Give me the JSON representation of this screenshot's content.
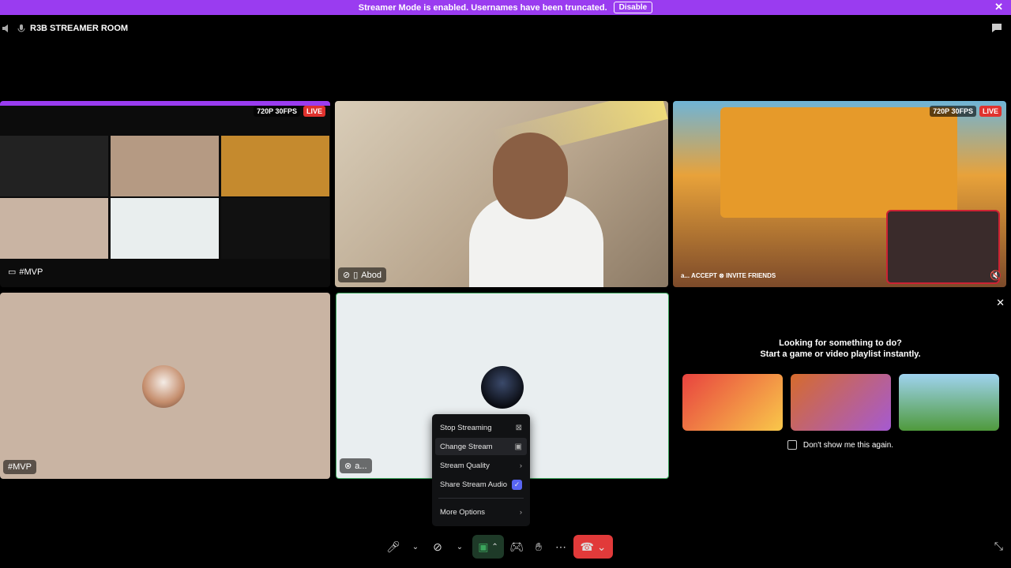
{
  "banner": {
    "text": "Streamer Mode is enabled. Usernames have been truncated.",
    "button": "Disable"
  },
  "channel": {
    "name": "R3B STREAMER ROOM"
  },
  "tiles": {
    "mvp_screen": {
      "label": "#MVP",
      "quality": "720P 30FPS",
      "live": "LIVE"
    },
    "abod": {
      "label": "Abod"
    },
    "game": {
      "quality": "720P 30FPS",
      "live": "LIVE",
      "caption": "a... ACCEPT  ⊗ INVITE FRIENDS"
    },
    "mvp_cam": {
      "label": "#MVP"
    },
    "self": {
      "label": "a..."
    }
  },
  "context_menu": {
    "items": [
      "Stop Streaming",
      "Change Stream",
      "Stream Quality",
      "Share Stream Audio",
      "More Options"
    ]
  },
  "suggest": {
    "title_line1": "Looking for something to do?",
    "title_line2": "Start a game or video playlist instantly.",
    "dont_show": "Don't show me this again."
  },
  "colors": {
    "banner": "#9a3cf0",
    "accent": "#5865f2",
    "end_call": "#e13a3a",
    "speaking": "#3ba55c"
  }
}
